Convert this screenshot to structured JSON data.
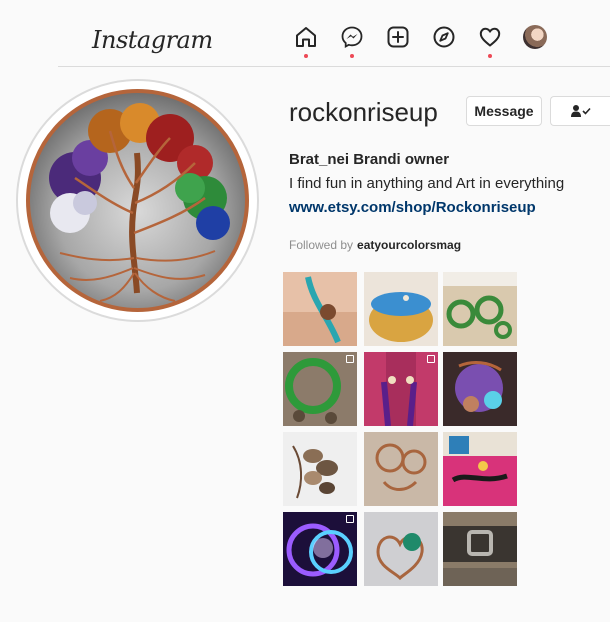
{
  "app": {
    "logo": "Instagram"
  },
  "nav": {
    "icons": [
      {
        "name": "home-icon",
        "notification": true
      },
      {
        "name": "messenger-icon",
        "notification": true
      },
      {
        "name": "new-post-icon",
        "notification": false
      },
      {
        "name": "explore-icon",
        "notification": false
      },
      {
        "name": "activity-heart-icon",
        "notification": true
      },
      {
        "name": "profile-avatar",
        "notification": false
      }
    ],
    "notification_color": "#ed4956"
  },
  "profile": {
    "username": "rockonriseup",
    "message_button": "Message",
    "full_name": "Brat_nei Brandi owner",
    "bio": "I find fun in anything and Art in everything",
    "website": "www.etsy.com/shop/Rockonriseup",
    "followed_by_label": "Followed by",
    "followed_by_user": "eatyourcolorsmag"
  },
  "colors": {
    "link": "#00376b",
    "border": "#dbdbdb",
    "muted": "#8e8e8e"
  }
}
